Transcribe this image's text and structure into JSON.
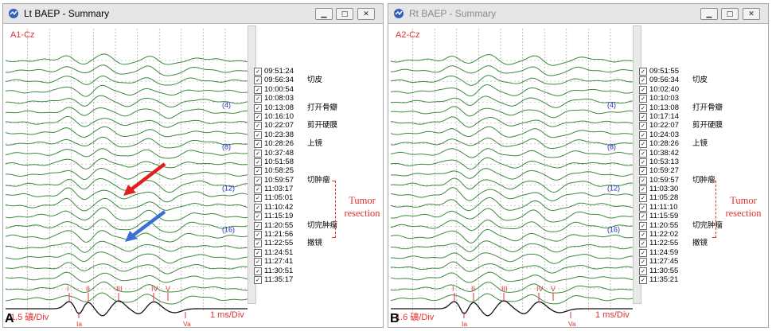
{
  "colors": {
    "trace": "#3a8a3a",
    "marker": "#e03030",
    "arrow_red": "#e02020",
    "arrow_blue": "#3a6fd8",
    "peak_label": "#2030c0",
    "grid": "#9a9a9a",
    "bottom_trace": "#111111"
  },
  "tumor_label": {
    "line1": "Tumor",
    "line2": "resection"
  },
  "icons": {
    "app": "app-icon",
    "minimize": "minimize-icon",
    "maximize": "maximize-icon",
    "close": "close-icon"
  },
  "panels": [
    {
      "letter": "A",
      "title": "Lt BAEP - Summary",
      "channel": "A1-Cz",
      "gain": "1.5 礦/Div",
      "timebase": "1 ms/Div",
      "peaks": [
        "I",
        "II",
        "III",
        "IV",
        "V"
      ],
      "sub_peaks": [
        "Ia",
        "Va"
      ],
      "trace_labels": [
        "(4)",
        "(8)",
        "(12)",
        "(16)"
      ],
      "arrows": [
        "red",
        "blue"
      ],
      "trials": [
        {
          "time": "09:51:24",
          "note": ""
        },
        {
          "time": "09:56:34",
          "note": "切皮"
        },
        {
          "time": "10:00:54",
          "note": ""
        },
        {
          "time": "10:08:03",
          "note": ""
        },
        {
          "time": "10:13:08",
          "note": "打开骨瓣"
        },
        {
          "time": "10:16:10",
          "note": ""
        },
        {
          "time": "10:22:07",
          "note": "剪开硬膜"
        },
        {
          "time": "10:23:38",
          "note": ""
        },
        {
          "time": "10:28:26",
          "note": "上镜"
        },
        {
          "time": "10:37:48",
          "note": ""
        },
        {
          "time": "10:51:58",
          "note": ""
        },
        {
          "time": "10:58:25",
          "note": ""
        },
        {
          "time": "10:59:57",
          "note": "切肿瘤"
        },
        {
          "time": "11:03:17",
          "note": ""
        },
        {
          "time": "11:05:01",
          "note": ""
        },
        {
          "time": "11:10:42",
          "note": ""
        },
        {
          "time": "11:15:19",
          "note": ""
        },
        {
          "time": "11:20:55",
          "note": "切完肿瘤"
        },
        {
          "time": "11:21:56",
          "note": ""
        },
        {
          "time": "11:22:55",
          "note": "撤镜"
        },
        {
          "time": "11:24:51",
          "note": ""
        },
        {
          "time": "11:27:41",
          "note": ""
        },
        {
          "time": "11:30:51",
          "note": ""
        },
        {
          "time": "11:35:17",
          "note": ""
        }
      ]
    },
    {
      "letter": "B",
      "title": "Rt BAEP - Summary",
      "channel": "A2-Cz",
      "gain": "1.6 礦/Div",
      "timebase": "1 ms/Div",
      "peaks": [
        "I",
        "II",
        "III",
        "IV",
        "V"
      ],
      "sub_peaks": [
        "Ia",
        "Va"
      ],
      "trace_labels": [
        "(4)",
        "(8)",
        "(12)",
        "(16)"
      ],
      "arrows": [],
      "trials": [
        {
          "time": "09:51:55",
          "note": ""
        },
        {
          "time": "09:56:34",
          "note": "切皮"
        },
        {
          "time": "10:02:40",
          "note": ""
        },
        {
          "time": "10:10:03",
          "note": ""
        },
        {
          "time": "10:13:08",
          "note": "打开骨瓣"
        },
        {
          "time": "10:17:14",
          "note": ""
        },
        {
          "time": "10:22:07",
          "note": "剪开硬膜"
        },
        {
          "time": "10:24:03",
          "note": ""
        },
        {
          "time": "10:28:26",
          "note": "上镜"
        },
        {
          "time": "10:38:42",
          "note": ""
        },
        {
          "time": "10:53:13",
          "note": ""
        },
        {
          "time": "10:59:27",
          "note": ""
        },
        {
          "time": "10:59:57",
          "note": "切肿瘤"
        },
        {
          "time": "11:03:30",
          "note": ""
        },
        {
          "time": "11:05:28",
          "note": ""
        },
        {
          "time": "11:11:10",
          "note": ""
        },
        {
          "time": "11:15:59",
          "note": ""
        },
        {
          "time": "11:20:55",
          "note": "切完肿瘤"
        },
        {
          "time": "11:22:02",
          "note": ""
        },
        {
          "time": "11:22:55",
          "note": "撤镜"
        },
        {
          "time": "11:24:59",
          "note": ""
        },
        {
          "time": "11:27:45",
          "note": ""
        },
        {
          "time": "11:30:55",
          "note": ""
        },
        {
          "time": "11:35:21",
          "note": ""
        }
      ]
    }
  ]
}
